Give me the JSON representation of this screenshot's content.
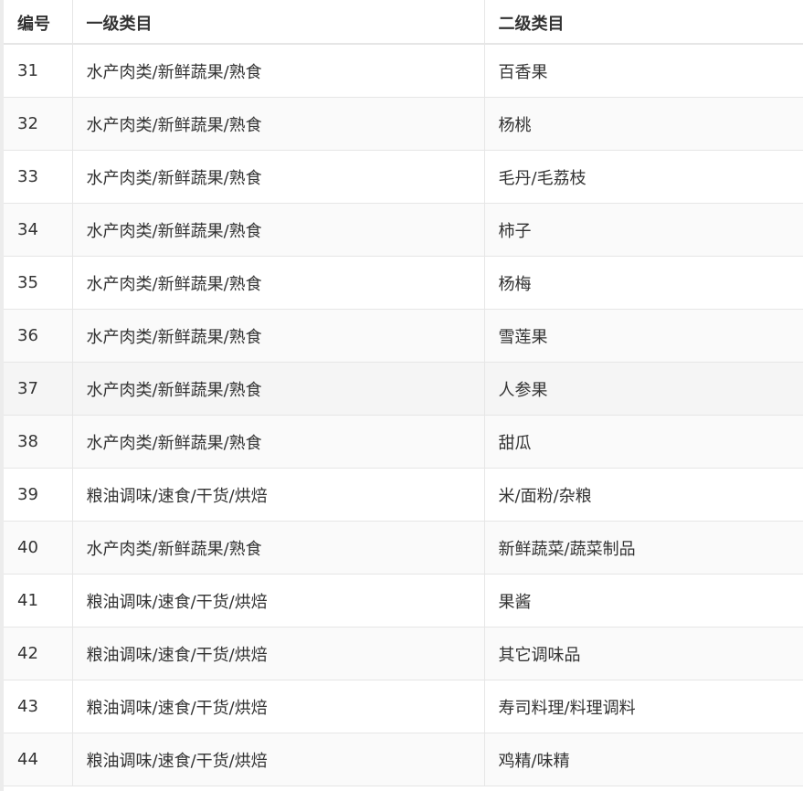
{
  "table": {
    "headers": [
      "编号",
      "一级类目",
      "二级类目"
    ],
    "rows": [
      [
        "31",
        "水产肉类/新鲜蔬果/熟食",
        "百香果"
      ],
      [
        "32",
        "水产肉类/新鲜蔬果/熟食",
        "杨桃"
      ],
      [
        "33",
        "水产肉类/新鲜蔬果/熟食",
        "毛丹/毛荔枝"
      ],
      [
        "34",
        "水产肉类/新鲜蔬果/熟食",
        "柿子"
      ],
      [
        "35",
        "水产肉类/新鲜蔬果/熟食",
        "杨梅"
      ],
      [
        "36",
        "水产肉类/新鲜蔬果/熟食",
        "雪莲果"
      ],
      [
        "37",
        "水产肉类/新鲜蔬果/熟食",
        "人参果"
      ],
      [
        "38",
        "水产肉类/新鲜蔬果/熟食",
        "甜瓜"
      ],
      [
        "39",
        "粮油调味/速食/干货/烘焙",
        "米/面粉/杂粮"
      ],
      [
        "40",
        "水产肉类/新鲜蔬果/熟食",
        "新鲜蔬菜/蔬菜制品"
      ],
      [
        "41",
        "粮油调味/速食/干货/烘焙",
        "果酱"
      ],
      [
        "42",
        "粮油调味/速食/干货/烘焙",
        "其它调味品"
      ],
      [
        "43",
        "粮油调味/速食/干货/烘焙",
        "寿司料理/料理调料"
      ],
      [
        "44",
        "粮油调味/速食/干货/烘焙",
        "鸡精/味精"
      ]
    ]
  }
}
